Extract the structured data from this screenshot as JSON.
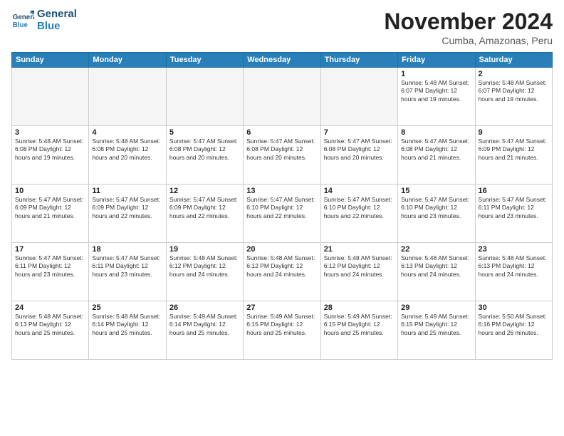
{
  "header": {
    "logo_line1": "General",
    "logo_line2": "Blue",
    "month": "November 2024",
    "location": "Cumba, Amazonas, Peru"
  },
  "weekdays": [
    "Sunday",
    "Monday",
    "Tuesday",
    "Wednesday",
    "Thursday",
    "Friday",
    "Saturday"
  ],
  "weeks": [
    [
      {
        "day": "",
        "info": "",
        "empty": true
      },
      {
        "day": "",
        "info": "",
        "empty": true
      },
      {
        "day": "",
        "info": "",
        "empty": true
      },
      {
        "day": "",
        "info": "",
        "empty": true
      },
      {
        "day": "",
        "info": "",
        "empty": true
      },
      {
        "day": "1",
        "info": "Sunrise: 5:48 AM\nSunset: 6:07 PM\nDaylight: 12 hours and 19 minutes."
      },
      {
        "day": "2",
        "info": "Sunrise: 5:48 AM\nSunset: 6:07 PM\nDaylight: 12 hours and 19 minutes."
      }
    ],
    [
      {
        "day": "3",
        "info": "Sunrise: 5:48 AM\nSunset: 6:08 PM\nDaylight: 12 hours and 19 minutes."
      },
      {
        "day": "4",
        "info": "Sunrise: 5:48 AM\nSunset: 6:08 PM\nDaylight: 12 hours and 20 minutes."
      },
      {
        "day": "5",
        "info": "Sunrise: 5:47 AM\nSunset: 6:08 PM\nDaylight: 12 hours and 20 minutes."
      },
      {
        "day": "6",
        "info": "Sunrise: 5:47 AM\nSunset: 6:08 PM\nDaylight: 12 hours and 20 minutes."
      },
      {
        "day": "7",
        "info": "Sunrise: 5:47 AM\nSunset: 6:08 PM\nDaylight: 12 hours and 20 minutes."
      },
      {
        "day": "8",
        "info": "Sunrise: 5:47 AM\nSunset: 6:08 PM\nDaylight: 12 hours and 21 minutes."
      },
      {
        "day": "9",
        "info": "Sunrise: 5:47 AM\nSunset: 6:09 PM\nDaylight: 12 hours and 21 minutes."
      }
    ],
    [
      {
        "day": "10",
        "info": "Sunrise: 5:47 AM\nSunset: 6:09 PM\nDaylight: 12 hours and 21 minutes."
      },
      {
        "day": "11",
        "info": "Sunrise: 5:47 AM\nSunset: 6:09 PM\nDaylight: 12 hours and 22 minutes."
      },
      {
        "day": "12",
        "info": "Sunrise: 5:47 AM\nSunset: 6:09 PM\nDaylight: 12 hours and 22 minutes."
      },
      {
        "day": "13",
        "info": "Sunrise: 5:47 AM\nSunset: 6:10 PM\nDaylight: 12 hours and 22 minutes."
      },
      {
        "day": "14",
        "info": "Sunrise: 5:47 AM\nSunset: 6:10 PM\nDaylight: 12 hours and 22 minutes."
      },
      {
        "day": "15",
        "info": "Sunrise: 5:47 AM\nSunset: 6:10 PM\nDaylight: 12 hours and 23 minutes."
      },
      {
        "day": "16",
        "info": "Sunrise: 5:47 AM\nSunset: 6:11 PM\nDaylight: 12 hours and 23 minutes."
      }
    ],
    [
      {
        "day": "17",
        "info": "Sunrise: 5:47 AM\nSunset: 6:11 PM\nDaylight: 12 hours and 23 minutes."
      },
      {
        "day": "18",
        "info": "Sunrise: 5:47 AM\nSunset: 6:11 PM\nDaylight: 12 hours and 23 minutes."
      },
      {
        "day": "19",
        "info": "Sunrise: 5:48 AM\nSunset: 6:12 PM\nDaylight: 12 hours and 24 minutes."
      },
      {
        "day": "20",
        "info": "Sunrise: 5:48 AM\nSunset: 6:12 PM\nDaylight: 12 hours and 24 minutes."
      },
      {
        "day": "21",
        "info": "Sunrise: 5:48 AM\nSunset: 6:12 PM\nDaylight: 12 hours and 24 minutes."
      },
      {
        "day": "22",
        "info": "Sunrise: 5:48 AM\nSunset: 6:13 PM\nDaylight: 12 hours and 24 minutes."
      },
      {
        "day": "23",
        "info": "Sunrise: 5:48 AM\nSunset: 6:13 PM\nDaylight: 12 hours and 24 minutes."
      }
    ],
    [
      {
        "day": "24",
        "info": "Sunrise: 5:48 AM\nSunset: 6:13 PM\nDaylight: 12 hours and 25 minutes."
      },
      {
        "day": "25",
        "info": "Sunrise: 5:48 AM\nSunset: 6:14 PM\nDaylight: 12 hours and 25 minutes."
      },
      {
        "day": "26",
        "info": "Sunrise: 5:49 AM\nSunset: 6:14 PM\nDaylight: 12 hours and 25 minutes."
      },
      {
        "day": "27",
        "info": "Sunrise: 5:49 AM\nSunset: 6:15 PM\nDaylight: 12 hours and 25 minutes."
      },
      {
        "day": "28",
        "info": "Sunrise: 5:49 AM\nSunset: 6:15 PM\nDaylight: 12 hours and 25 minutes."
      },
      {
        "day": "29",
        "info": "Sunrise: 5:49 AM\nSunset: 6:15 PM\nDaylight: 12 hours and 25 minutes."
      },
      {
        "day": "30",
        "info": "Sunrise: 5:50 AM\nSunset: 6:16 PM\nDaylight: 12 hours and 26 minutes."
      }
    ]
  ]
}
